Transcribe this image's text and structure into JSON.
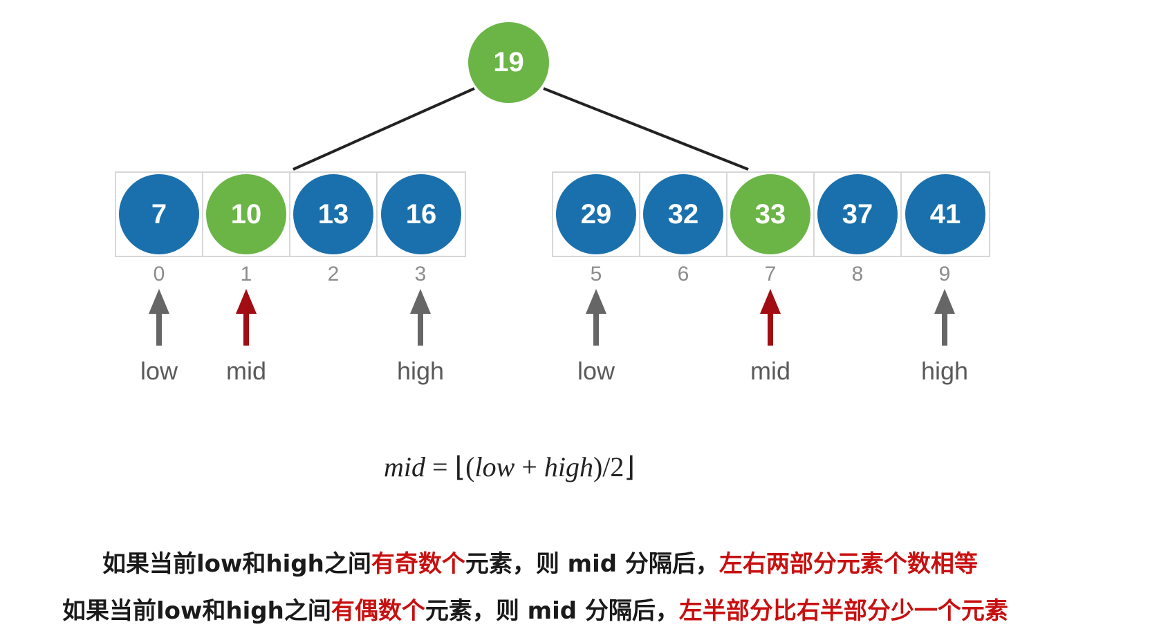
{
  "tree": {
    "root": "19",
    "left_array": [
      {
        "value": "7",
        "index": "0",
        "highlight": false
      },
      {
        "value": "10",
        "index": "1",
        "highlight": true
      },
      {
        "value": "13",
        "index": "2",
        "highlight": false
      },
      {
        "value": "16",
        "index": "3",
        "highlight": false
      }
    ],
    "right_array": [
      {
        "value": "29",
        "index": "5",
        "highlight": false
      },
      {
        "value": "32",
        "index": "6",
        "highlight": false
      },
      {
        "value": "33",
        "index": "7",
        "highlight": true
      },
      {
        "value": "37",
        "index": "8",
        "highlight": false
      },
      {
        "value": "41",
        "index": "9",
        "highlight": false
      }
    ]
  },
  "pointers": {
    "left_low": "low",
    "left_mid": "mid",
    "left_high": "high",
    "right_low": "low",
    "right_mid": "mid",
    "right_high": "high"
  },
  "formula": {
    "lhs": "mid",
    "eq": "=",
    "lfloor": "⌊(",
    "low": "low",
    "plus": "+",
    "high": "high",
    "tail": ")/2⌋"
  },
  "descriptions": {
    "line1": {
      "p1": "如果当前low和high之间",
      "r1": "有奇数个",
      "p2": "元素，则 mid 分隔后，",
      "r2": "左右两部分元素个数相等"
    },
    "line2": {
      "p1": "如果当前low和high之间",
      "r1": "有偶数个",
      "p2": "元素，则 mid 分隔后，",
      "r2": "左半部分比右半部分少一个元素"
    }
  },
  "colors": {
    "node_blue": "#1a70ad",
    "node_green": "#6ab546",
    "pointer_gray": "#666666",
    "pointer_red": "#a10d12",
    "text_red": "#c81010"
  }
}
